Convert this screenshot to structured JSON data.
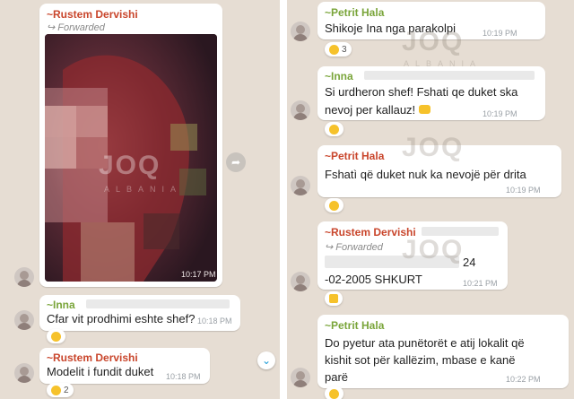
{
  "left": {
    "msg1": {
      "sender": "~Rustem Dervishi",
      "forwarded": "Forwarded",
      "time": "10:17 PM"
    },
    "msg2": {
      "sender": "~Inna",
      "text": "Cfar vit prodhimi eshte shef?",
      "time": "10:18 PM"
    },
    "msg3": {
      "sender": "~Rustem Dervishi",
      "text": "Modelit i fundit duket",
      "time": "10:18 PM",
      "reaction_count": "2"
    }
  },
  "right": {
    "msg1": {
      "sender": "~Petrit Hala",
      "text": "Shikoje Ina nga parakolpi",
      "time": "10:19 PM",
      "reaction_count": "3"
    },
    "msg2": {
      "sender": "~Inna",
      "line1": "Si urdheron shef! Fshati qe duket ska",
      "line2": "nevoj per kallauz!",
      "time": "10:19 PM"
    },
    "msg3": {
      "sender": "~Petrit Hala",
      "text": "Fshatì që duket nuk ka nevojë për drita",
      "time": "10:19 PM"
    },
    "msg4": {
      "sender": "~Rustem Dervishi",
      "forwarded": "Forwarded",
      "line1": "24",
      "line2": "-02-2005 SHKURT",
      "time": "10:21 PM"
    },
    "msg5": {
      "sender": "~Petrit Hala",
      "line1": "Do pyetur ata punëtorët e atij lokalit që",
      "line2": "kishit sot për kallëzim, mbase e kanë",
      "line3": "parë",
      "time": "10:22 PM"
    }
  },
  "watermark": {
    "brand": "JOQ",
    "sub": "ALBANIA"
  },
  "colors": {
    "chat_bg": "#e6ddd3",
    "bubble": "#ffffff",
    "sender_red": "#c9462c",
    "sender_green": "#7aa53a",
    "time": "#9aa0a6"
  }
}
